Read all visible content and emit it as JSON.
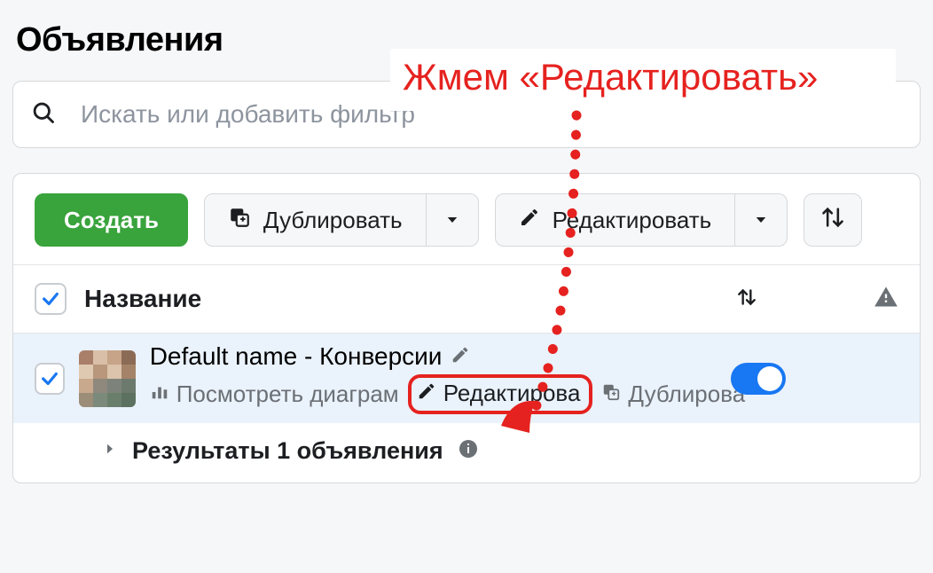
{
  "page_title": "Объявления",
  "annotation_text": "Жмем «Редактировать»",
  "search": {
    "placeholder": "Искать или добавить фильтр"
  },
  "toolbar": {
    "create_label": "Создать",
    "duplicate_label": "Дублировать",
    "edit_label": "Редактировать"
  },
  "columns": {
    "name_label": "Название"
  },
  "row": {
    "title": "Default name - Конверсии",
    "view_chart_label": "Посмотреть диаграм",
    "edit_label": "Редактирова",
    "duplicate_label": "Дублирова",
    "toggle_on": true
  },
  "summary": {
    "results_label": "Результаты 1 объявления"
  },
  "colors": {
    "accent_green": "#39a33c",
    "fb_blue": "#1877f2",
    "red": "#e5221f"
  }
}
